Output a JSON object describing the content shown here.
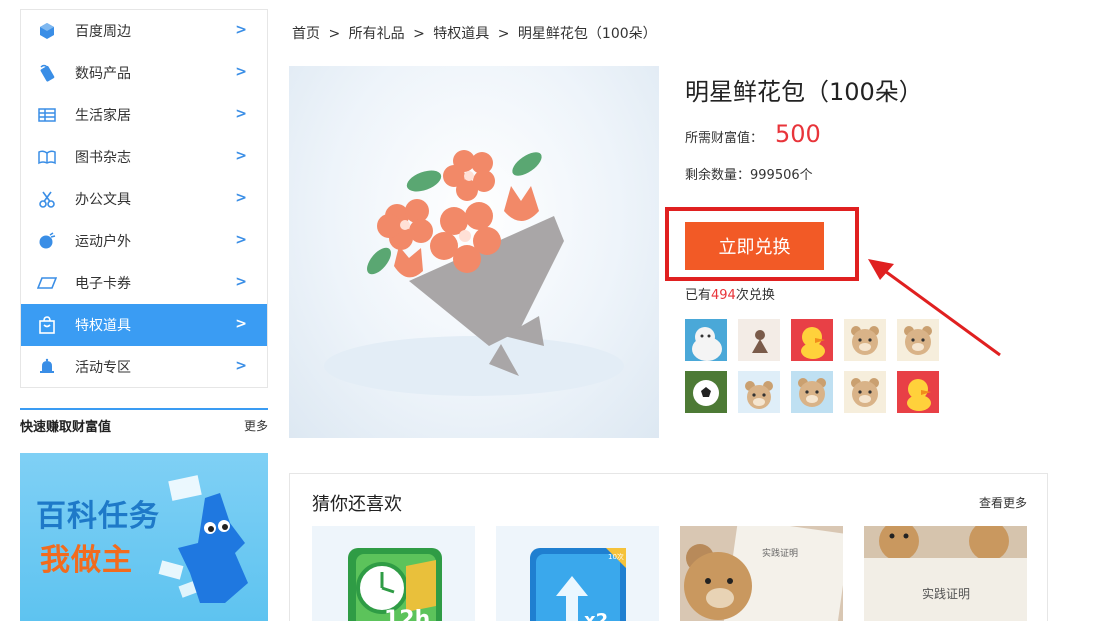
{
  "sidebar": {
    "items": [
      {
        "label": "百度周边",
        "icon": "cube-icon"
      },
      {
        "label": "数码产品",
        "icon": "phone-icon"
      },
      {
        "label": "生活家居",
        "icon": "table-icon"
      },
      {
        "label": "图书杂志",
        "icon": "book-icon"
      },
      {
        "label": "办公文具",
        "icon": "scissors-icon"
      },
      {
        "label": "运动户外",
        "icon": "ball-icon"
      },
      {
        "label": "电子卡券",
        "icon": "card-icon"
      },
      {
        "label": "特权道具",
        "icon": "bag-icon",
        "active": true
      },
      {
        "label": "活动专区",
        "icon": "bell-icon"
      }
    ],
    "chevron": ">"
  },
  "quick": {
    "title": "快速赚取财富值",
    "more": "更多"
  },
  "banner": {
    "line1": "百科任务",
    "line2": "我做主"
  },
  "breadcrumb": [
    "首页",
    ">",
    "所有礼品",
    ">",
    "特权道具",
    ">",
    "明星鲜花包（100朵）"
  ],
  "product": {
    "title": "明星鲜花包（100朵）",
    "price_label": "所需财富值：",
    "price": "500",
    "stock_label": "剩余数量：",
    "stock_value": "999506个",
    "redeem_button": "立即兑换",
    "count_prefix": "已有",
    "count": "494",
    "count_suffix": "次兑换"
  },
  "colors": {
    "accent_blue": "#3a9cf3",
    "button_orange": "#f25a26",
    "price_red": "#e8343a",
    "highlight_red": "#e02020"
  },
  "recommend": {
    "title": "猜你还喜欢",
    "more": "查看更多",
    "items": [
      {
        "label": "12h"
      },
      {
        "label": "x2",
        "badge": "10次"
      },
      {
        "label": "实践证明"
      },
      {
        "label": "实践证明"
      }
    ]
  }
}
